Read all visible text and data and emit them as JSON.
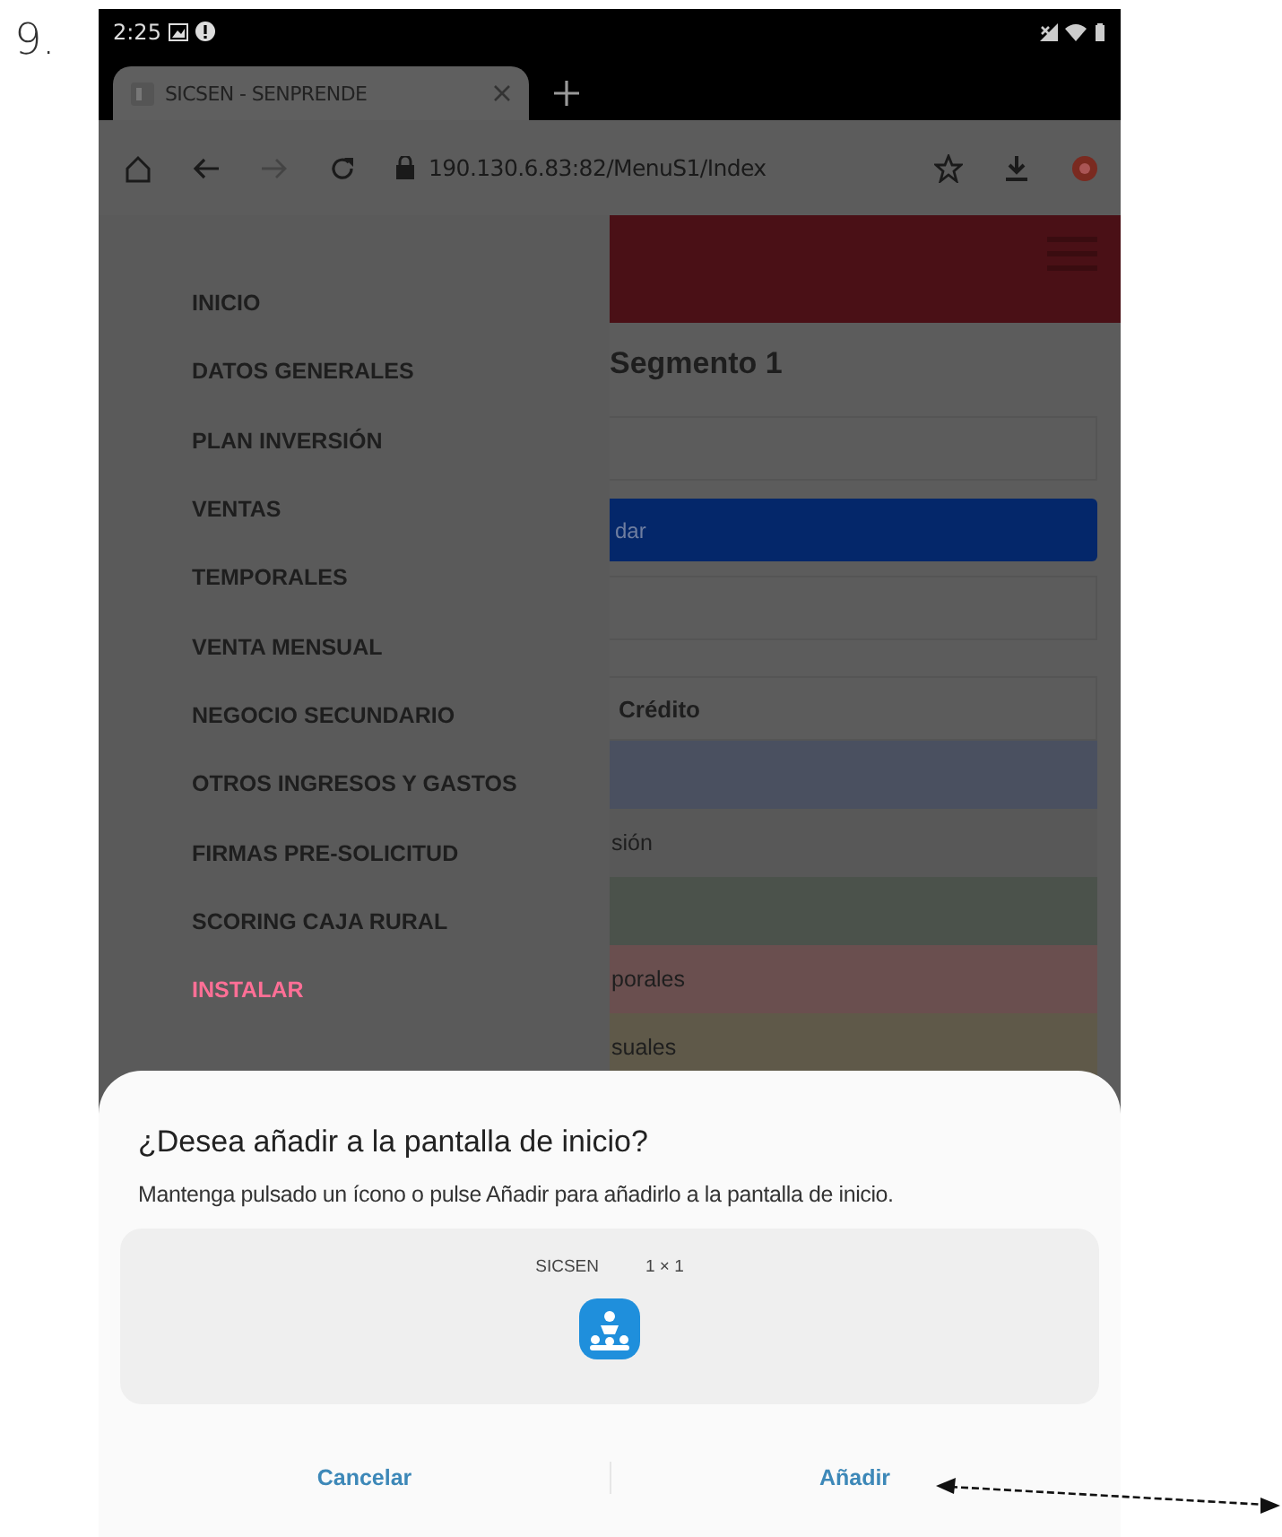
{
  "document": {
    "number": "9."
  },
  "status_bar": {
    "time": "2:25"
  },
  "browser": {
    "tabs": [
      {
        "title": "SICSEN - SENPRENDE",
        "selected": true
      }
    ],
    "address": "190.130.6.83:82/MenuS1/Index"
  },
  "drawer": {
    "items": [
      {
        "label": "INICIO",
        "kind": "link"
      },
      {
        "label": "DATOS GENERALES",
        "kind": "link"
      },
      {
        "label": "PLAN INVERSIÓN",
        "kind": "link"
      },
      {
        "label": "VENTAS",
        "kind": "link"
      },
      {
        "label": "TEMPORALES",
        "kind": "link"
      },
      {
        "label": "VENTA MENSUAL",
        "kind": "link"
      },
      {
        "label": "NEGOCIO SECUNDARIO",
        "kind": "link"
      },
      {
        "label": "OTROS INGRESOS Y GASTOS",
        "kind": "link"
      },
      {
        "label": "FIRMAS PRE-SOLICITUD",
        "kind": "link"
      },
      {
        "label": "SCORING CAJA RURAL",
        "kind": "link"
      },
      {
        "label": "INSTALAR",
        "kind": "install"
      }
    ]
  },
  "page": {
    "heading": "Segmento 1",
    "button": "dar",
    "section": "Crédito",
    "rows": [
      {
        "color": "#4a5060"
      },
      {
        "label": "sión",
        "color": "#585858"
      },
      {
        "color": "#4b524b"
      },
      {
        "label": "porales",
        "color": "#6a4f4f"
      },
      {
        "label": "suales",
        "color": "#5f5949"
      }
    ]
  },
  "dialog": {
    "title": "¿Desea añadir a la pantalla de inicio?",
    "message": "Mantenga pulsado un ícono o pulse Añadir para añadirlo a la pantalla de inicio.",
    "preview": {
      "app_name": "SICSEN",
      "size": "1 × 1"
    },
    "buttons": [
      {
        "label": "Cancelar"
      },
      {
        "label": "Añadir"
      }
    ]
  }
}
